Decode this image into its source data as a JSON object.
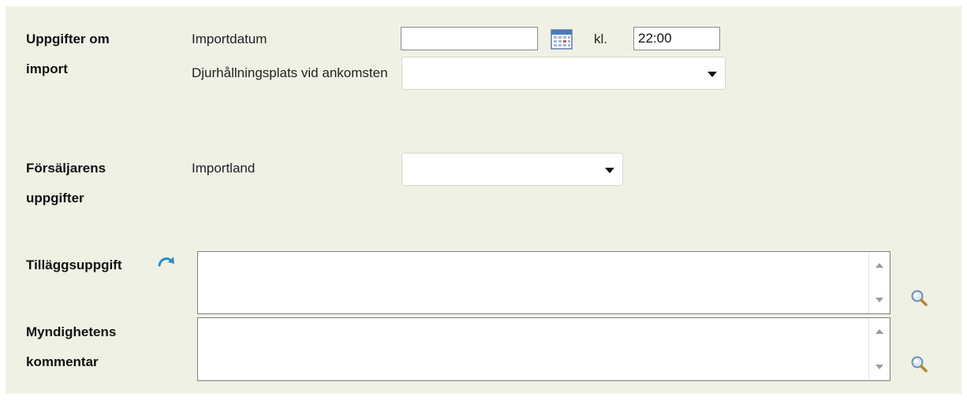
{
  "import_section": {
    "label": "Uppgifter om import",
    "date_label": "Importdatum",
    "date_value": "",
    "time_label": "kl.",
    "time_value": "22:00",
    "holding_label": "Djurhållningsplats vid ankomsten",
    "holding_value": ""
  },
  "seller_section": {
    "label": "Försäljarens uppgifter",
    "country_label": "Importland",
    "country_value": ""
  },
  "extra_info": {
    "label": "Tilläggsuppgift",
    "value": ""
  },
  "authority_comment": {
    "label": "Myndighetens kommentar",
    "value": ""
  },
  "icons": {
    "calendar": "calendar-icon",
    "refresh": "refresh-arrow-icon",
    "magnifier": "magnifier-icon"
  },
  "colors": {
    "panel_background": "#f0f1e5",
    "refresh_arrow": "#2a8fd0"
  }
}
